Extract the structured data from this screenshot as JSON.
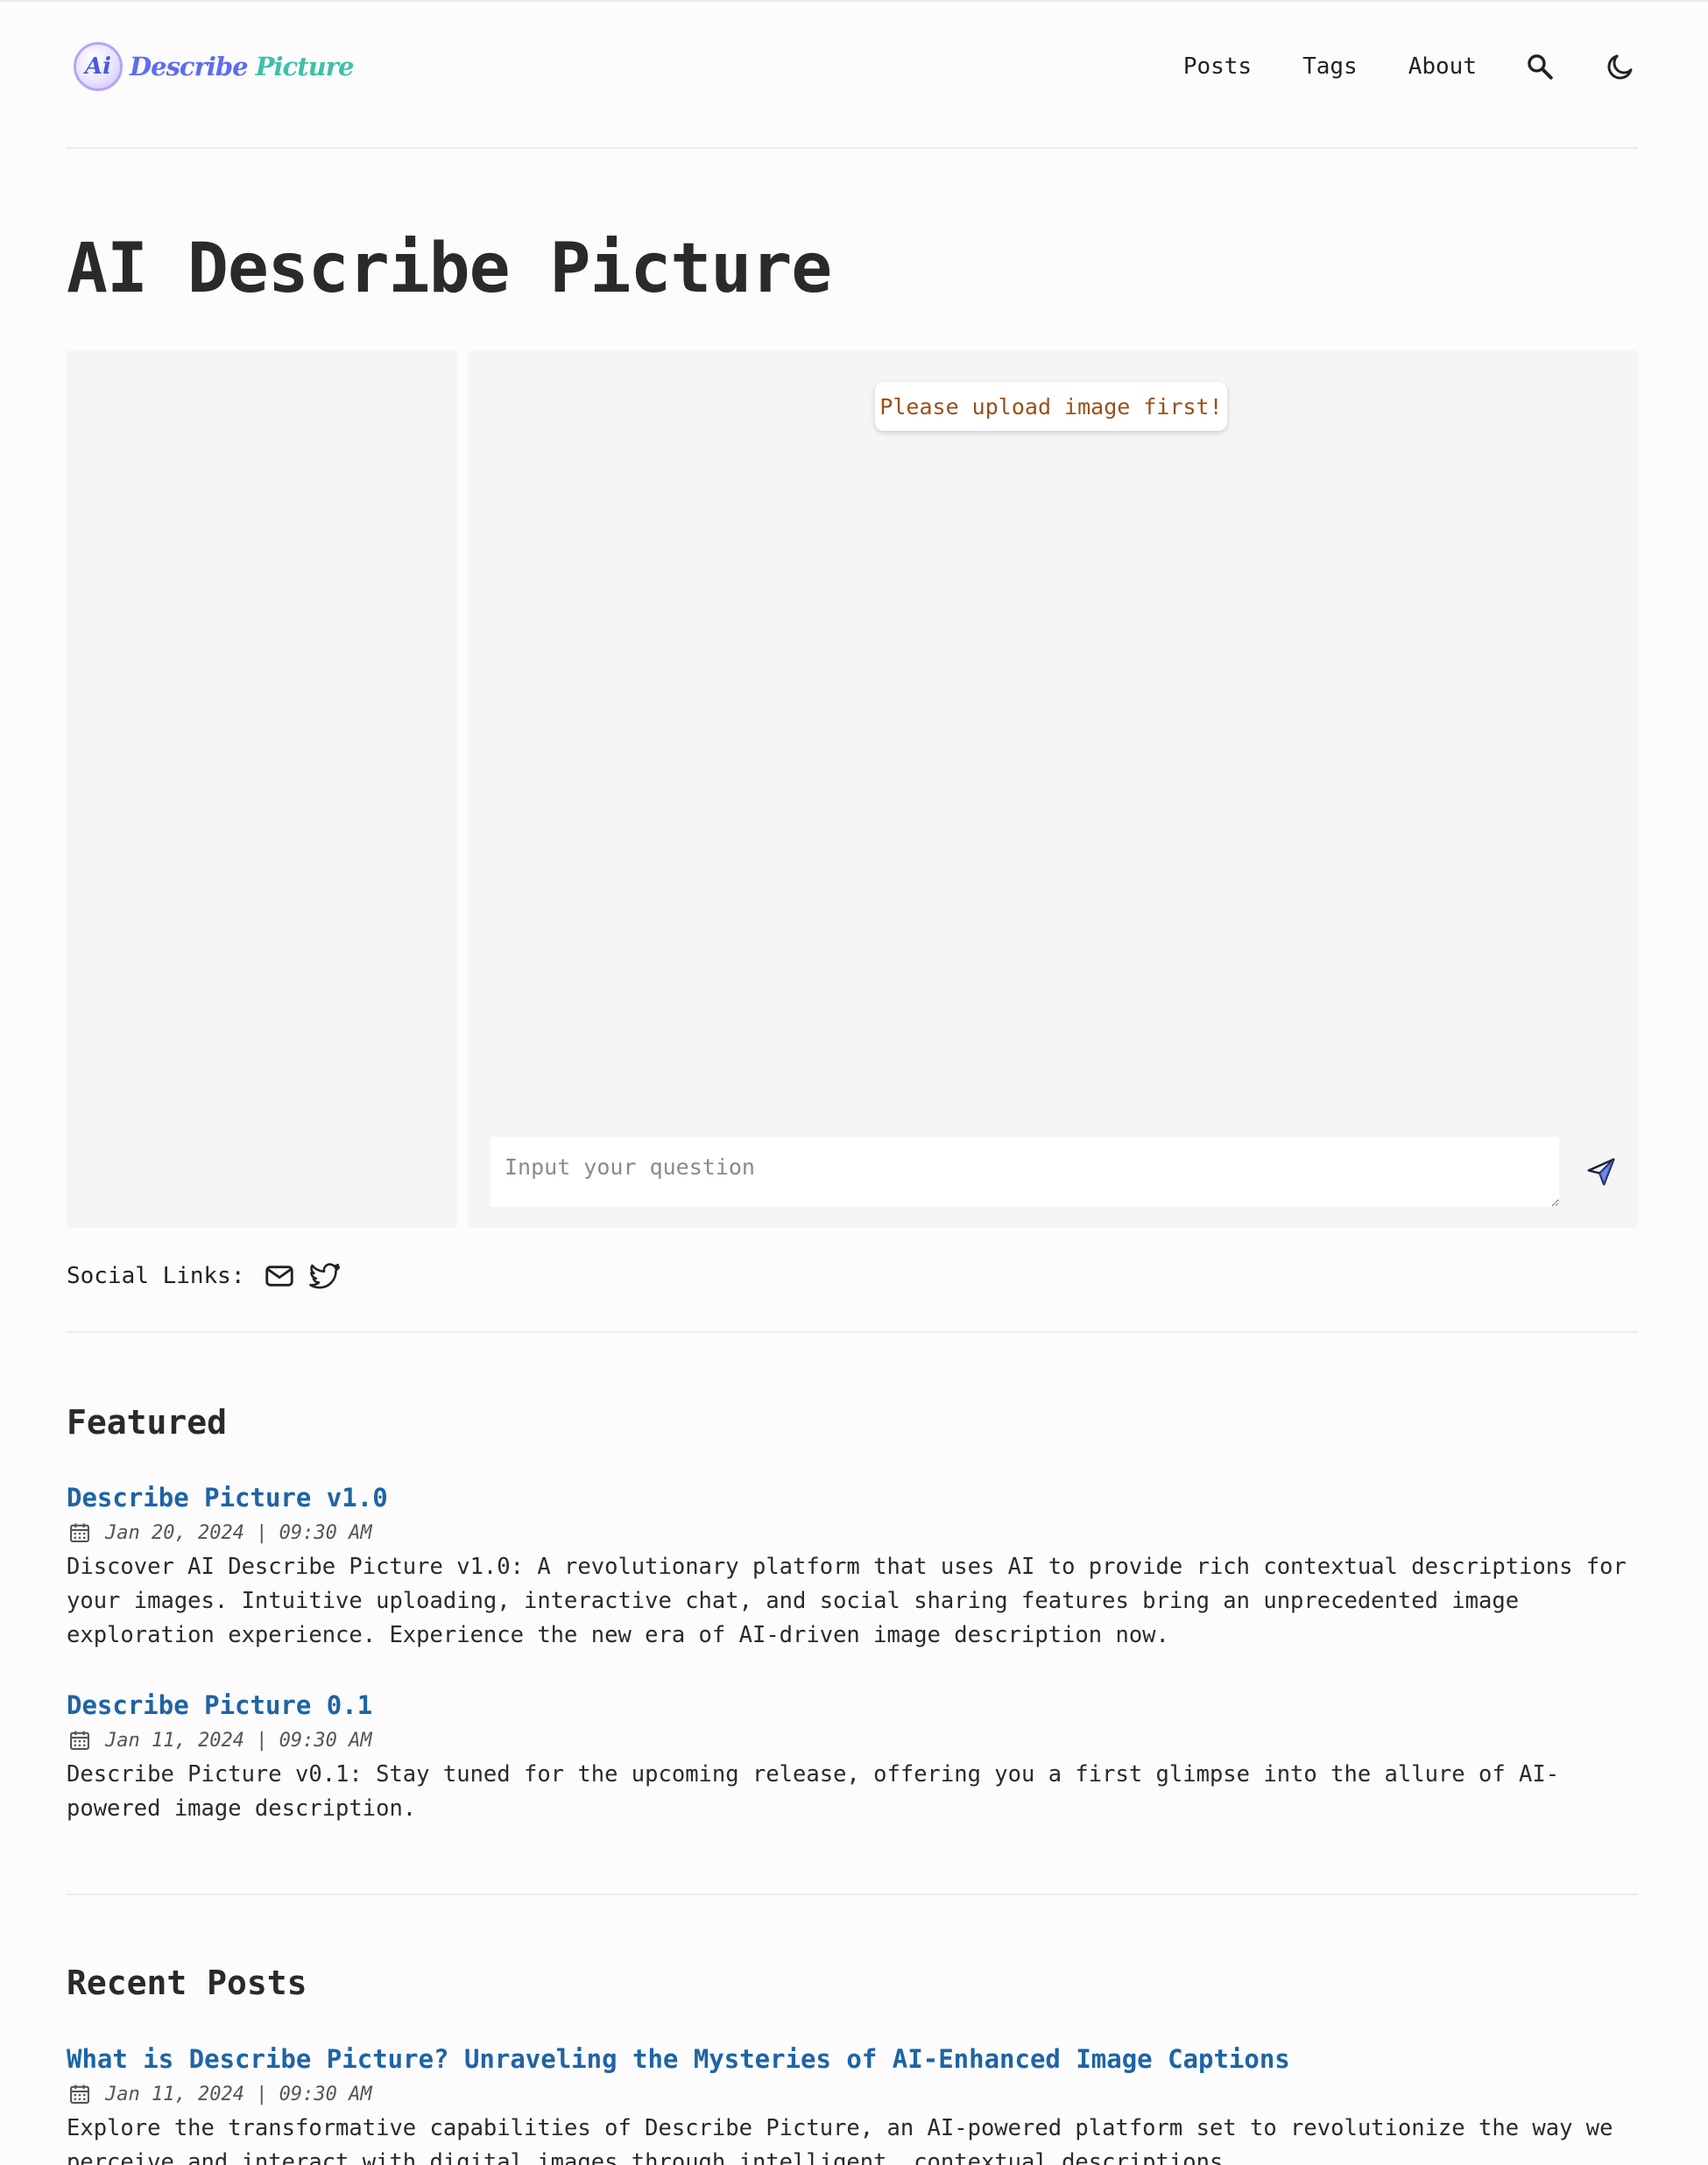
{
  "header": {
    "logo_badge": "Ai",
    "logo_word1": "Describe",
    "logo_word2": "Picture",
    "nav": [
      "Posts",
      "Tags",
      "About"
    ],
    "search_icon": "search-icon",
    "theme_icon": "moon-icon"
  },
  "main": {
    "title": "AI Describe Picture",
    "toast": "Please upload image first!",
    "question_placeholder": "Input your question",
    "send_icon": "send-icon"
  },
  "social": {
    "label": "Social Links:",
    "icons": [
      "mail-icon",
      "twitter-icon"
    ]
  },
  "featured": {
    "heading": "Featured",
    "posts": [
      {
        "title": "Describe Picture v1.0",
        "date": "Jan 20, 2024 | 09:30 AM",
        "desc": "Discover AI Describe Picture v1.0: A revolutionary platform that uses AI to provide rich contextual descriptions for your images. Intuitive uploading, interactive chat, and social sharing features bring an unprecedented image exploration experience. Experience the new era of AI-driven image description now."
      },
      {
        "title": "Describe Picture 0.1",
        "date": "Jan 11, 2024 | 09:30 AM",
        "desc": "Describe Picture v0.1: Stay tuned for the upcoming release, offering you a first glimpse into the allure of AI-powered image description."
      }
    ]
  },
  "recent": {
    "heading": "Recent Posts",
    "posts": [
      {
        "title": "What is Describe Picture? Unraveling the Mysteries of AI-Enhanced Image Captions",
        "date": "Jan 11, 2024 | 09:30 AM",
        "desc": "Explore the transformative capabilities of Describe Picture, an AI-powered platform set to revolutionize the way we perceive and interact with digital images through intelligent, contextual descriptions."
      }
    ]
  },
  "colors": {
    "link": "#1e64a6",
    "toast_text": "#9a4f1a",
    "panel_bg": "#f5f5f6",
    "page_bg": "#fbfcfb"
  }
}
